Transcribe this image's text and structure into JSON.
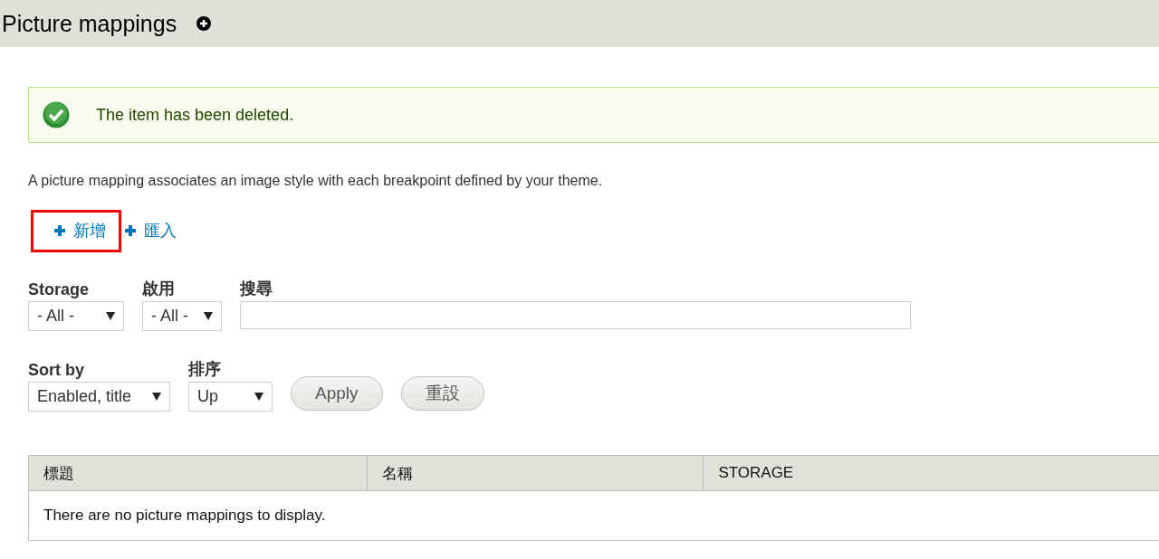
{
  "header": {
    "title": "Picture mappings"
  },
  "message": {
    "text": "The item has been deleted."
  },
  "description": "A picture mapping associates an image style with each breakpoint defined by your theme.",
  "action_links": [
    {
      "label": "新增",
      "highlighted": true
    },
    {
      "label": "匯入",
      "highlighted": false
    }
  ],
  "filters": [
    {
      "kind": "select",
      "label": "Storage",
      "value": "- All -"
    },
    {
      "kind": "select",
      "label": "啟用",
      "value": "- All -"
    },
    {
      "kind": "text",
      "label": "搜尋"
    }
  ],
  "sort": [
    {
      "kind": "select",
      "label": "Sort by",
      "value": "Enabled, title"
    },
    {
      "kind": "select",
      "label": "排序",
      "value": "Up"
    }
  ],
  "buttons": [
    "Apply",
    "重設"
  ],
  "table": {
    "columns": [
      "標題",
      "名稱",
      "STORAGE"
    ],
    "empty": "There are no picture mappings to display."
  }
}
